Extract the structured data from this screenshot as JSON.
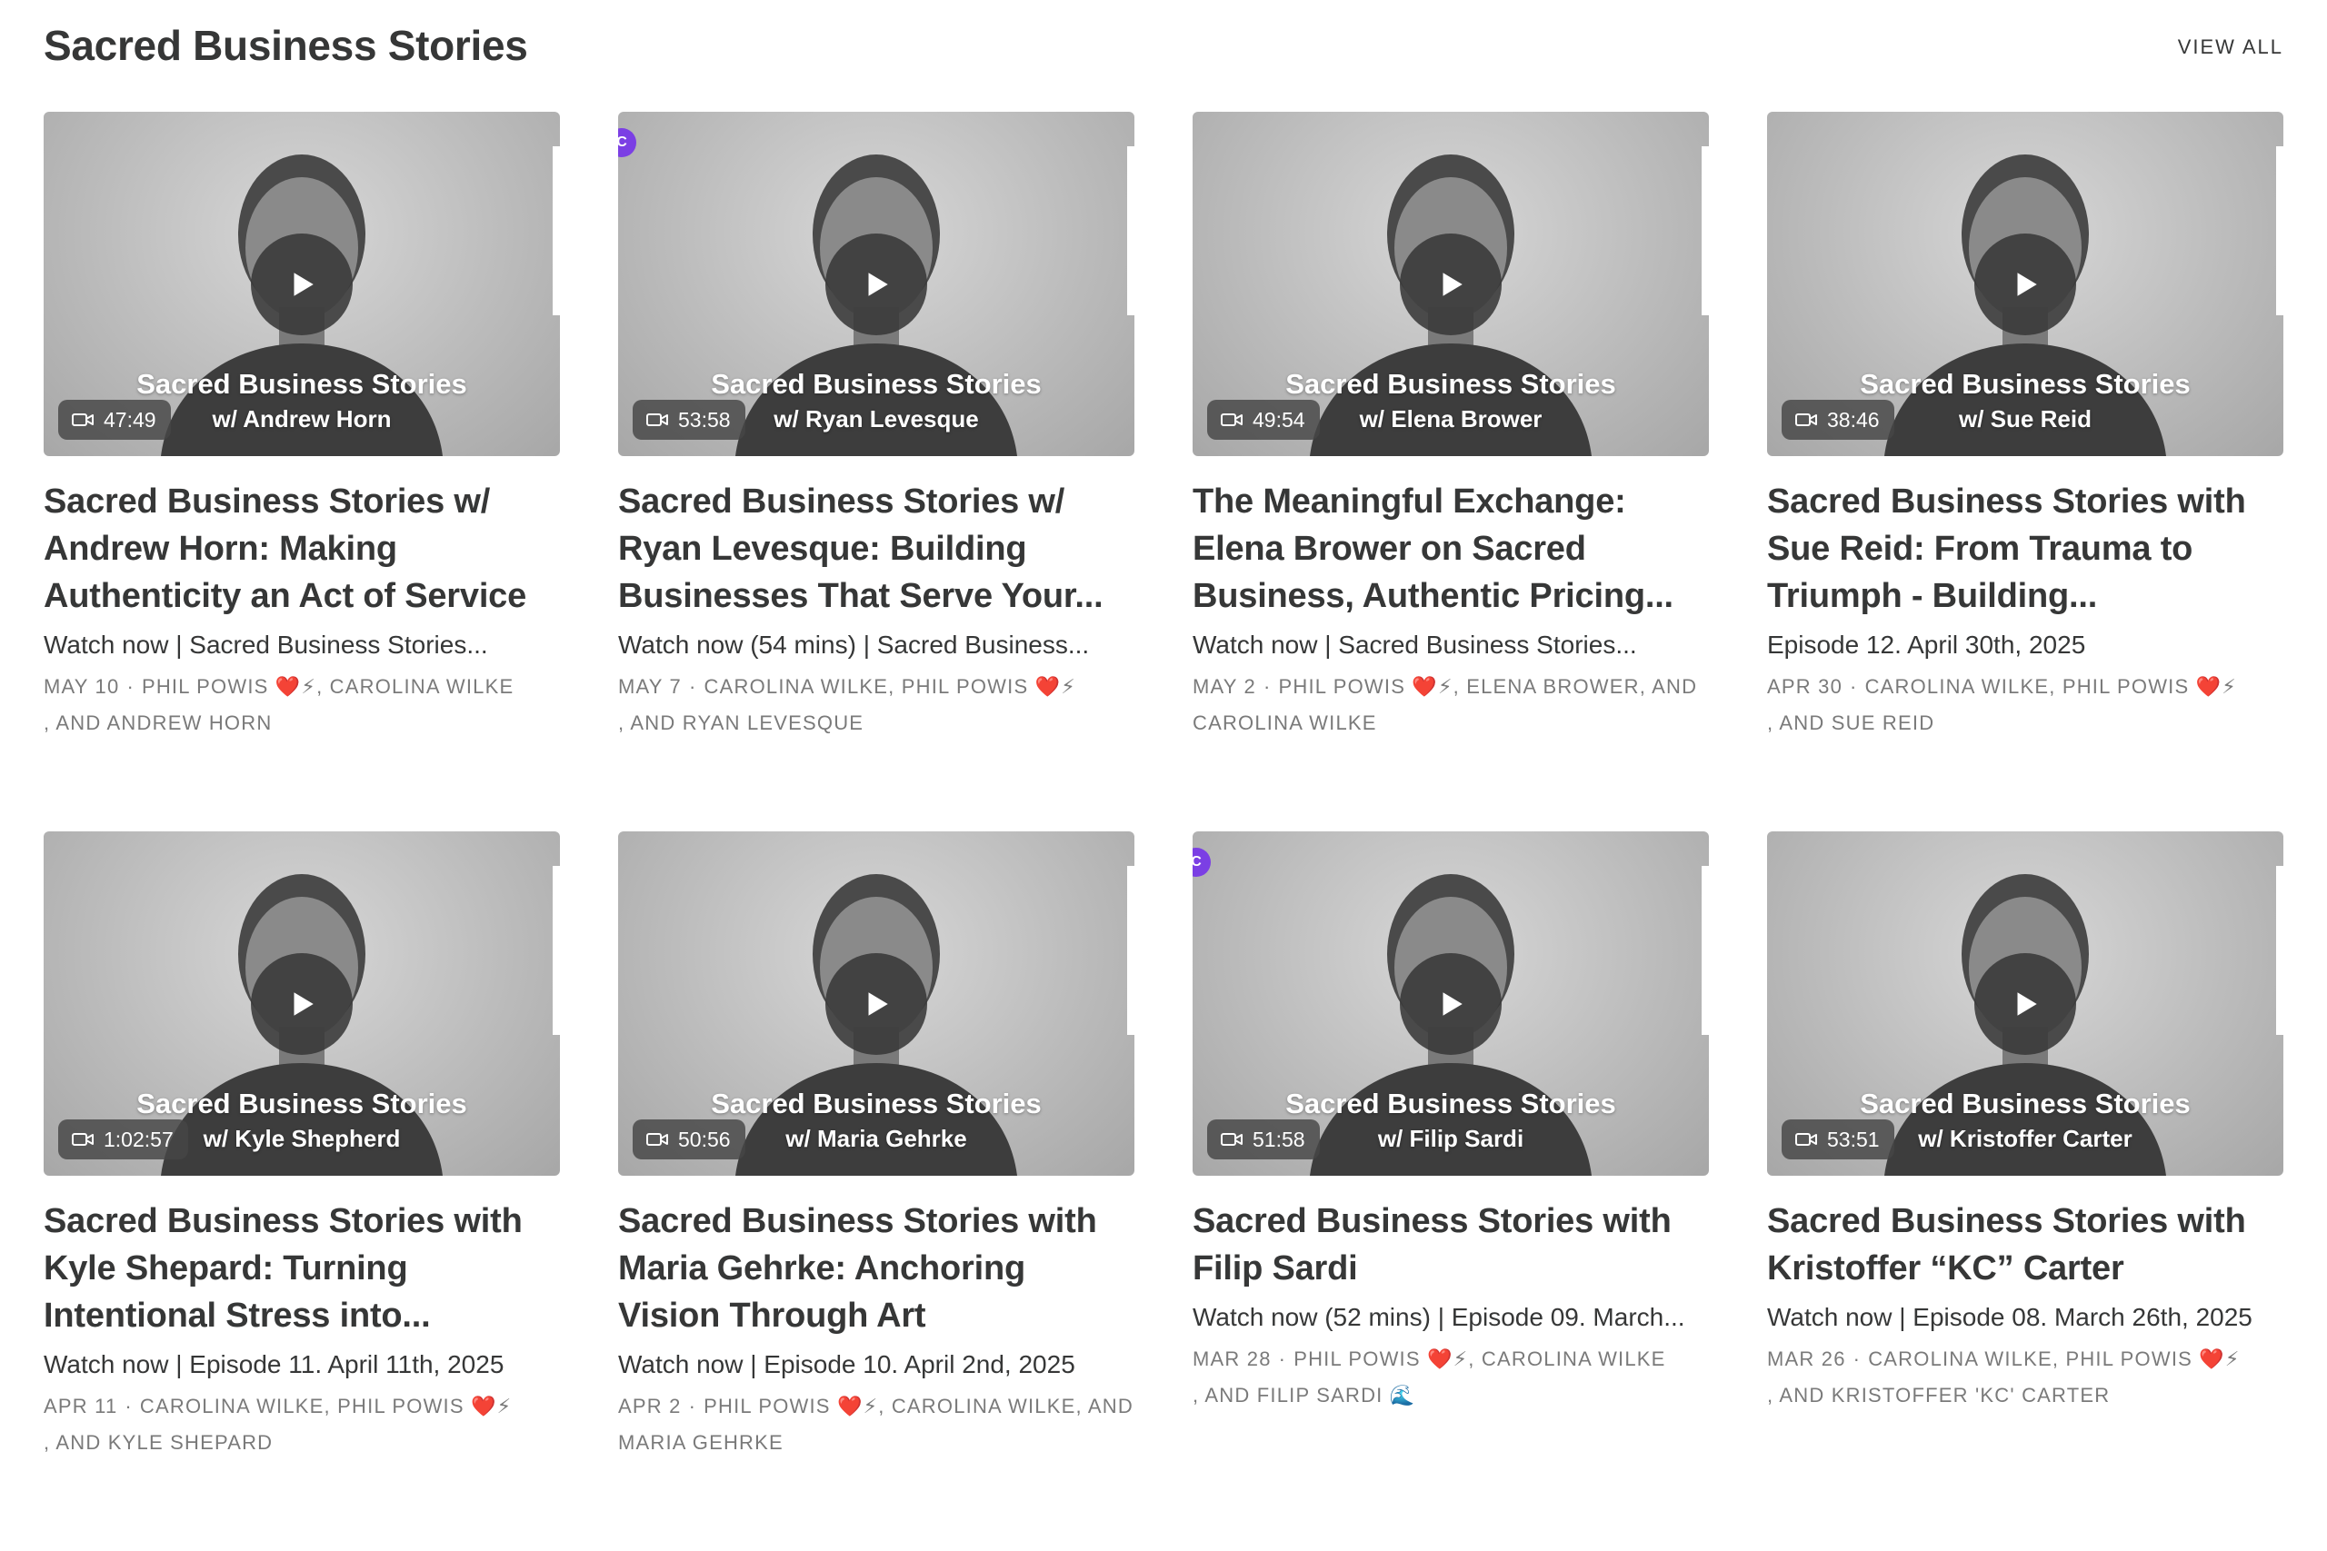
{
  "section": {
    "title": "Sacred Business Stories",
    "view_all": "VIEW ALL"
  },
  "icons": {
    "play": "play-icon",
    "video": "video-camera-icon",
    "badge": "community-badge-icon"
  },
  "colors": {
    "badge": "#7b3fe4",
    "text": "#363737",
    "meta": "#7a7a7a"
  },
  "cards": [
    {
      "overlay_title": "Sacred Business Stories",
      "overlay_sub": "w/ Andrew Horn",
      "duration": "47:49",
      "title": "Sacred Business Stories w/ Andrew Horn: Making Authenticity an Act of Service",
      "description": "Watch now | Sacred Business Stories...",
      "date": "MAY 10",
      "authors_line1": "PHIL POWIS ❤️⚡, CAROLINA WILKE",
      "authors_line2": ", AND ANDREW HORN",
      "badge": false
    },
    {
      "overlay_title": "Sacred Business Stories",
      "overlay_sub": "w/ Ryan Levesque",
      "duration": "53:58",
      "title": "Sacred Business Stories w/ Ryan Levesque: Building Businesses That Serve Your...",
      "description": "Watch now (54 mins) | Sacred Business...",
      "date": "MAY 7",
      "authors_line1": "CAROLINA WILKE, PHIL POWIS ❤️⚡",
      "authors_line2": ", AND RYAN LEVESQUE",
      "badge": true
    },
    {
      "overlay_title": "Sacred Business Stories",
      "overlay_sub": "w/ Elena Brower",
      "duration": "49:54",
      "title": "The Meaningful Exchange: Elena Brower on Sacred Business, Authentic Pricing...",
      "description": "Watch now | Sacred Business Stories...",
      "date": "MAY 2",
      "authors_line1": "PHIL POWIS ❤️⚡, ELENA BROWER, AND",
      "authors_line2": "CAROLINA WILKE",
      "badge": false
    },
    {
      "overlay_title": "Sacred Business Stories",
      "overlay_sub": "w/ Sue Reid",
      "duration": "38:46",
      "title": "Sacred Business Stories with Sue Reid: From Trauma to Triumph - Building...",
      "description": "Episode 12. April 30th, 2025",
      "date": "APR 30",
      "authors_line1": "CAROLINA WILKE, PHIL POWIS ❤️⚡",
      "authors_line2": ", AND SUE REID",
      "badge": false
    },
    {
      "overlay_title": "Sacred Business Stories",
      "overlay_sub": "w/ Kyle Shepherd",
      "duration": "1:02:57",
      "title": "Sacred Business Stories with Kyle Shepard: Turning Intentional Stress into...",
      "description": "Watch now | Episode 11. April 11th, 2025",
      "date": "APR 11",
      "authors_line1": "CAROLINA WILKE, PHIL POWIS ❤️⚡",
      "authors_line2": ", AND KYLE SHEPARD",
      "badge": false
    },
    {
      "overlay_title": "Sacred Business Stories",
      "overlay_sub": "w/ Maria Gehrke",
      "duration": "50:56",
      "title": "Sacred Business Stories with Maria Gehrke: Anchoring Vision Through Art",
      "description": "Watch now | Episode 10. April 2nd, 2025",
      "date": "APR 2",
      "authors_line1": "PHIL POWIS ❤️⚡, CAROLINA WILKE, AND",
      "authors_line2": "MARIA GEHRKE",
      "badge": false
    },
    {
      "overlay_title": "Sacred Business Stories",
      "overlay_sub": "w/ Filip Sardi",
      "duration": "51:58",
      "title": "Sacred Business Stories with Filip Sardi",
      "description": "Watch now (52 mins) | Episode 09. March...",
      "date": "MAR 28",
      "authors_line1": "PHIL POWIS ❤️⚡, CAROLINA WILKE",
      "authors_line2": ", AND FILIP SARDI 🌊",
      "badge": true
    },
    {
      "overlay_title": "Sacred Business Stories",
      "overlay_sub": "w/ Kristoffer Carter",
      "duration": "53:51",
      "title": "Sacred Business Stories with Kristoffer “KC” Carter",
      "description": "Watch now | Episode 08. March 26th, 2025",
      "date": "MAR 26",
      "authors_line1": "CAROLINA WILKE, PHIL POWIS ❤️⚡",
      "authors_line2": ", AND KRISTOFFER 'KC' CARTER",
      "badge": false
    }
  ]
}
